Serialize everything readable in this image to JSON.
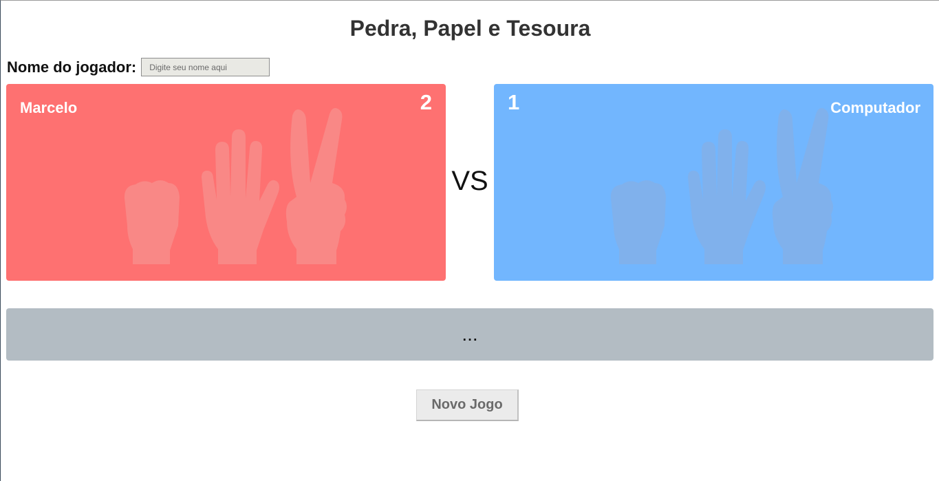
{
  "page": {
    "title": "Pedra, Papel e Tesoura"
  },
  "player_name": {
    "label": "Nome do jogador:",
    "placeholder": "Digite seu nome aqui",
    "value": ""
  },
  "player": {
    "name": "Marcelo",
    "score": "2"
  },
  "computer": {
    "name": "Computador",
    "score": "1"
  },
  "versus": "VS",
  "result": "...",
  "actions": {
    "new_game": "Novo Jogo"
  },
  "hands": [
    "rock-hand-icon",
    "paper-hand-icon",
    "scissors-hand-icon"
  ],
  "colors": {
    "player": "#fe7171",
    "computer": "#72b6fe",
    "result": "#b3bcc3"
  }
}
